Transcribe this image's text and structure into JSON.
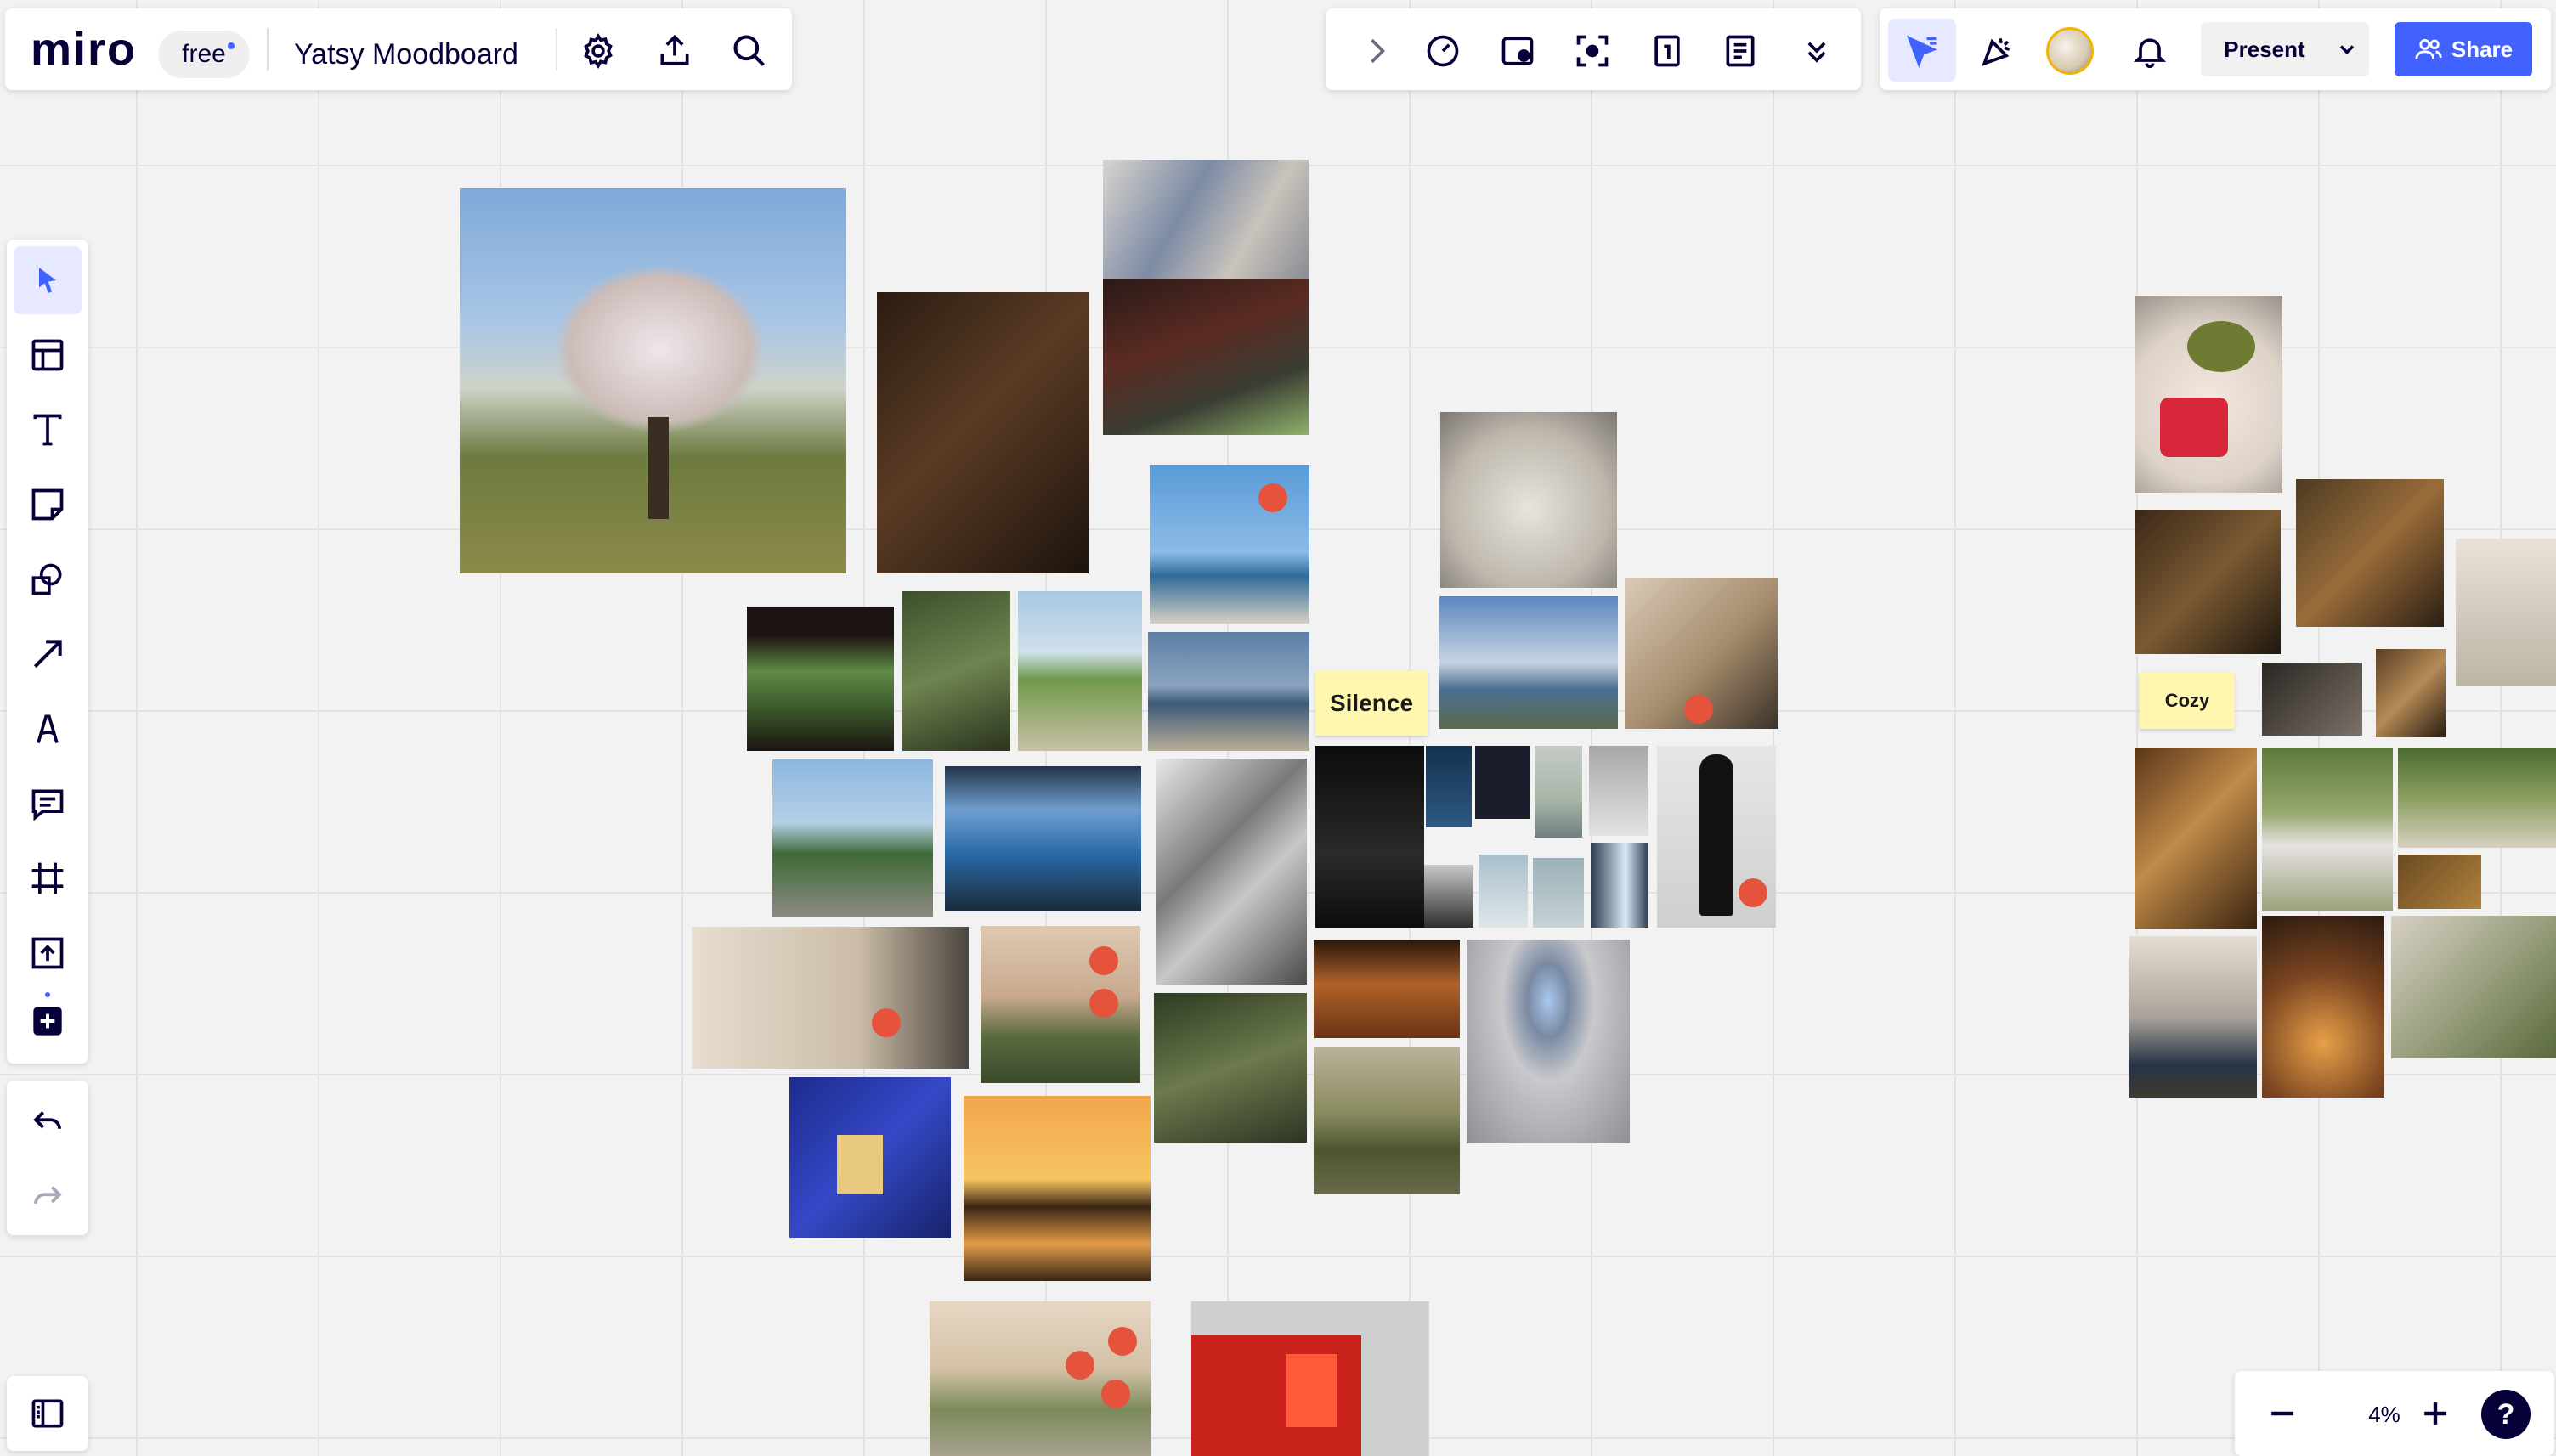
{
  "app": {
    "logo": "miro",
    "plan_badge": "free",
    "board_title": "Yatsy Moodboard"
  },
  "icons": {
    "top_left": [
      "settings-icon",
      "export-icon",
      "search-icon"
    ],
    "top_mid": [
      "chevron-right-icon",
      "timer-icon",
      "voting-icon",
      "attention-icon",
      "card-icon",
      "notes-icon",
      "more-icon"
    ],
    "left_toolbar": [
      "select-icon",
      "templates-icon",
      "text-icon",
      "sticky-note-icon",
      "shapes-icon",
      "line-icon",
      "pen-icon",
      "comment-icon",
      "frame-icon",
      "upload-icon",
      "more-apps-icon"
    ]
  },
  "header": {
    "present_label": "Present",
    "share_label": "Share"
  },
  "zoom": {
    "level": "4%"
  },
  "stickies": {
    "silence": "Silence",
    "cozy": "Cozy"
  },
  "colors": {
    "accent": "#4262ff",
    "marker": "#e5533d",
    "sticky": "#fff6b0"
  }
}
